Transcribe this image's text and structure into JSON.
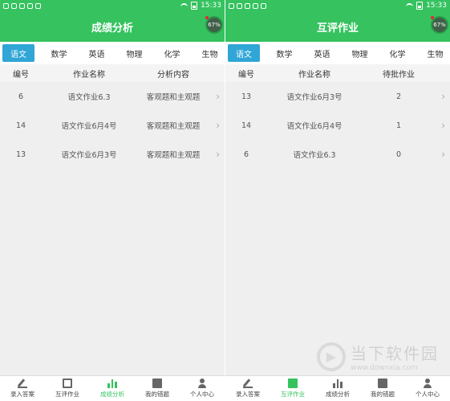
{
  "status": {
    "time": "15:33",
    "badge": "67%"
  },
  "tabs": [
    "语文",
    "数学",
    "英语",
    "物理",
    "化学",
    "生物"
  ],
  "left": {
    "title": "成绩分析",
    "headers": [
      "编号",
      "作业名称",
      "分析内容"
    ],
    "rows": [
      {
        "id": "6",
        "name": "语文作业6.3",
        "content": "客观题和主观题"
      },
      {
        "id": "14",
        "name": "语文作业6月4号",
        "content": "客观题和主观题"
      },
      {
        "id": "13",
        "name": "语文作业6月3号",
        "content": "客观题和主观题"
      }
    ]
  },
  "right": {
    "title": "互评作业",
    "headers": [
      "编号",
      "作业名称",
      "待批作业"
    ],
    "rows": [
      {
        "id": "13",
        "name": "语文作业6月3号",
        "content": "2"
      },
      {
        "id": "14",
        "name": "语文作业6月4号",
        "content": "1"
      },
      {
        "id": "6",
        "name": "语文作业6.3",
        "content": "0"
      }
    ]
  },
  "nav": [
    "录入答案",
    "互评作业",
    "成绩分析",
    "我的错题",
    "个人中心"
  ],
  "watermark": {
    "name": "当下软件园",
    "url": "www.downxia.com"
  },
  "colors": {
    "primary": "#35c25f",
    "tab_active": "#2fa6d6"
  }
}
